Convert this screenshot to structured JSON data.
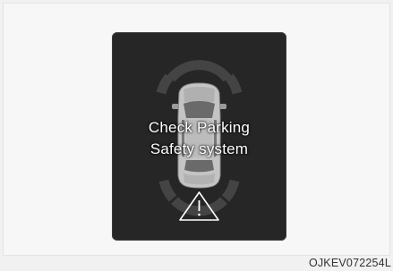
{
  "warning": {
    "line1": "Check Parking",
    "line2": "Safety system",
    "icon": "warning-triangle-icon"
  },
  "image_code": "OJKEV072254L",
  "colors": {
    "screen_bg": "#262626",
    "sensor_arc": "#4a4a4a",
    "car_body": "#bdbdbd",
    "text": "#ffffff"
  }
}
